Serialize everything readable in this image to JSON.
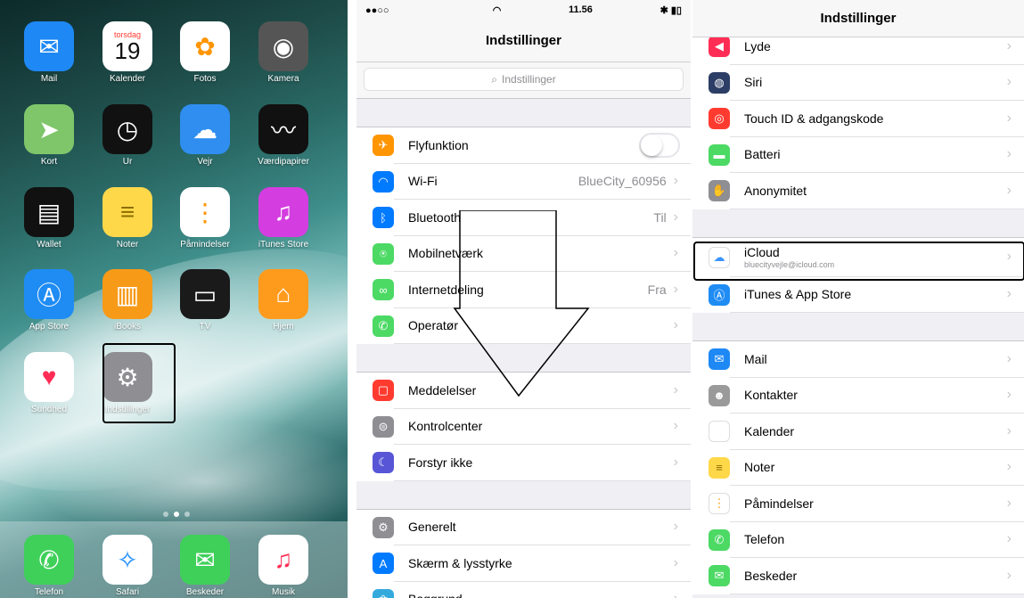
{
  "home": {
    "apps": [
      {
        "label": "Mail",
        "icon": "mail-icon",
        "color": "#1e88f5"
      },
      {
        "label": "Kalender",
        "icon": "calendar-icon",
        "color": "#ffffff",
        "day": "torsdag",
        "date": "19"
      },
      {
        "label": "Fotos",
        "icon": "photos-icon",
        "color": "#ffffff"
      },
      {
        "label": "Kamera",
        "icon": "camera-icon",
        "color": "#555555"
      },
      {
        "label": "Kort",
        "icon": "maps-icon",
        "color": "#7fc66b"
      },
      {
        "label": "Ur",
        "icon": "clock-icon",
        "color": "#111111"
      },
      {
        "label": "Vejr",
        "icon": "weather-icon",
        "color": "#2f8ef0"
      },
      {
        "label": "Værdipapirer",
        "icon": "stocks-icon",
        "color": "#111111"
      },
      {
        "label": "Wallet",
        "icon": "wallet-icon",
        "color": "#111111"
      },
      {
        "label": "Noter",
        "icon": "notes-icon",
        "color": "#ffd84a"
      },
      {
        "label": "Påmindelser",
        "icon": "reminders-icon",
        "color": "#ffffff"
      },
      {
        "label": "iTunes Store",
        "icon": "itunes-icon",
        "color": "#d43de0"
      },
      {
        "label": "App Store",
        "icon": "appstore-icon",
        "color": "#1f8cf4"
      },
      {
        "label": "iBooks",
        "icon": "ibooks-icon",
        "color": "#f79a18"
      },
      {
        "label": "TV",
        "icon": "tv-icon",
        "color": "#1a1a1a"
      },
      {
        "label": "Hjem",
        "icon": "home-icon",
        "color": "#ff9b1c"
      },
      {
        "label": "Sundhed",
        "icon": "health-icon",
        "color": "#ffffff"
      },
      {
        "label": "Indstillinger",
        "icon": "settings-icon",
        "color": "#8e8e93"
      }
    ],
    "dock": [
      {
        "label": "Telefon",
        "icon": "phone-icon",
        "color": "#3fd05a"
      },
      {
        "label": "Safari",
        "icon": "safari-icon",
        "color": "#ffffff"
      },
      {
        "label": "Beskeder",
        "icon": "messages-icon",
        "color": "#3fd05a"
      },
      {
        "label": "Musik",
        "icon": "music-icon",
        "color": "#ffffff"
      }
    ]
  },
  "settings1": {
    "time": "11.56",
    "title": "Indstillinger",
    "search_placeholder": "Indstillinger",
    "group1": [
      {
        "label": "Flyfunktion",
        "icon": "airplane-icon",
        "color": "#ff9500",
        "toggle": "off"
      },
      {
        "label": "Wi-Fi",
        "icon": "wifi-icon",
        "color": "#007aff",
        "value": "BlueCity_60956"
      },
      {
        "label": "Bluetooth",
        "icon": "bluetooth-icon",
        "color": "#007aff",
        "value": "Til"
      },
      {
        "label": "Mobilnetværk",
        "icon": "cellular-icon",
        "color": "#4cd964"
      },
      {
        "label": "Internetdeling",
        "icon": "hotspot-icon",
        "color": "#4cd964",
        "value": "Fra"
      },
      {
        "label": "Operatør",
        "icon": "carrier-icon",
        "color": "#4cd964"
      }
    ],
    "group2": [
      {
        "label": "Meddelelser",
        "icon": "notifications-icon",
        "color": "#ff3b30"
      },
      {
        "label": "Kontrolcenter",
        "icon": "control-center-icon",
        "color": "#8e8e93"
      },
      {
        "label": "Forstyr ikke",
        "icon": "moon-icon",
        "color": "#5856d6"
      }
    ],
    "group3": [
      {
        "label": "Generelt",
        "icon": "gear-icon",
        "color": "#8e8e93"
      },
      {
        "label": "Skærm & lysstyrke",
        "icon": "display-icon",
        "color": "#007aff"
      },
      {
        "label": "Baggrund",
        "icon": "wallpaper-icon",
        "color": "#34aadc"
      }
    ]
  },
  "settings2": {
    "title": "Indstillinger",
    "group1": [
      {
        "label": "Lyde",
        "icon": "sounds-icon",
        "color": "#ff2d55"
      },
      {
        "label": "Siri",
        "icon": "siri-icon",
        "color": "#2c3e66"
      },
      {
        "label": "Touch ID & adgangskode",
        "icon": "fingerprint-icon",
        "color": "#ff3b30"
      },
      {
        "label": "Batteri",
        "icon": "battery-icon",
        "color": "#4cd964"
      },
      {
        "label": "Anonymitet",
        "icon": "hand-icon",
        "color": "#8e8e93"
      }
    ],
    "group2": [
      {
        "label": "iCloud",
        "sub": "bluecityvejle@icloud.com",
        "icon": "icloud-icon",
        "color": "#ffffff"
      },
      {
        "label": "iTunes & App Store",
        "icon": "appstore-icon",
        "color": "#1f8cf4"
      }
    ],
    "group3": [
      {
        "label": "Mail",
        "icon": "mail-icon",
        "color": "#1e88f5"
      },
      {
        "label": "Kontakter",
        "icon": "contacts-icon",
        "color": "#9a9a9a"
      },
      {
        "label": "Kalender",
        "icon": "calendar-icon",
        "color": "#ffffff"
      },
      {
        "label": "Noter",
        "icon": "notes-icon",
        "color": "#ffd84a"
      },
      {
        "label": "Påmindelser",
        "icon": "reminders-icon",
        "color": "#ffffff"
      },
      {
        "label": "Telefon",
        "icon": "phone-icon",
        "color": "#4cd964"
      },
      {
        "label": "Beskeder",
        "icon": "messages-icon",
        "color": "#4cd964"
      }
    ]
  }
}
